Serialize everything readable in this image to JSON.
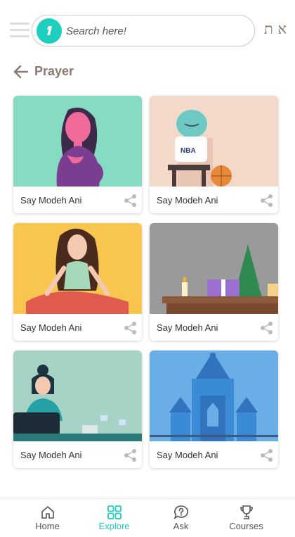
{
  "header": {
    "search_placeholder": "Search here!",
    "lang_toggle": "א ת"
  },
  "page": {
    "title": "Prayer"
  },
  "cards": [
    {
      "title": "Say Modeh Ani",
      "image": "woman-praying-illustration"
    },
    {
      "title": "Say Modeh Ani",
      "image": "nba-robot-illustration"
    },
    {
      "title": "Say Modeh Ani",
      "image": "meditating-woman-illustration"
    },
    {
      "title": "Say Modeh Ani",
      "image": "holiday-table-illustration"
    },
    {
      "title": "Say Modeh Ani",
      "image": "woman-at-desk-illustration"
    },
    {
      "title": "Say Modeh Ani",
      "image": "castle-illustration"
    }
  ],
  "bottom_nav": {
    "items": [
      {
        "label": "Home",
        "icon": "home-icon"
      },
      {
        "label": "Explore",
        "icon": "grid-icon",
        "active": true
      },
      {
        "label": "Ask",
        "icon": "question-icon"
      },
      {
        "label": "Courses",
        "icon": "trophy-icon"
      }
    ]
  },
  "colors": {
    "accent": "#1ccfbf",
    "title": "#8a7a72"
  }
}
